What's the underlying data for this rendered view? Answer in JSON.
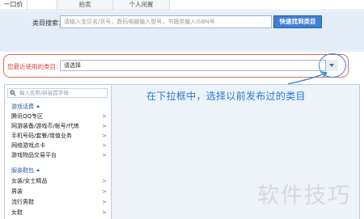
{
  "tabs": [
    {
      "label": "一口价"
    },
    {
      "label": "拍卖"
    },
    {
      "label": "个人闲置"
    }
  ],
  "search": {
    "label": "类目搜索：",
    "placeholder": "请输入宝贝名/货号，数码电器输入型号，书籍类输入ISBN号",
    "button": "快速找到类目"
  },
  "recent": {
    "label": "您最近使用的类目：",
    "selected": "请选择"
  },
  "category_search": {
    "placeholder": "输入名称/拼音首字母",
    "icon": "search-icon"
  },
  "groups": [
    {
      "title": "游戏话费",
      "items": [
        "腾讯QQ专区",
        "网游装备/游戏币/帐号/代练",
        "手机号码/套餐/增值业务",
        "网络游戏点卡",
        "游戏物品交易平台"
      ]
    },
    {
      "title": "服装鞋包",
      "items": [
        "女装/女士精品",
        "男装",
        "流行男鞋",
        "女鞋"
      ]
    }
  ],
  "annotation": "在下拉框中，选择以前发布过的类目",
  "watermark": "软件技巧",
  "colors": {
    "accent": "#3f7fd4",
    "highlight_outline": "#e56a4c",
    "annotation": "#2677d4",
    "search_band": "#e4eef9"
  }
}
